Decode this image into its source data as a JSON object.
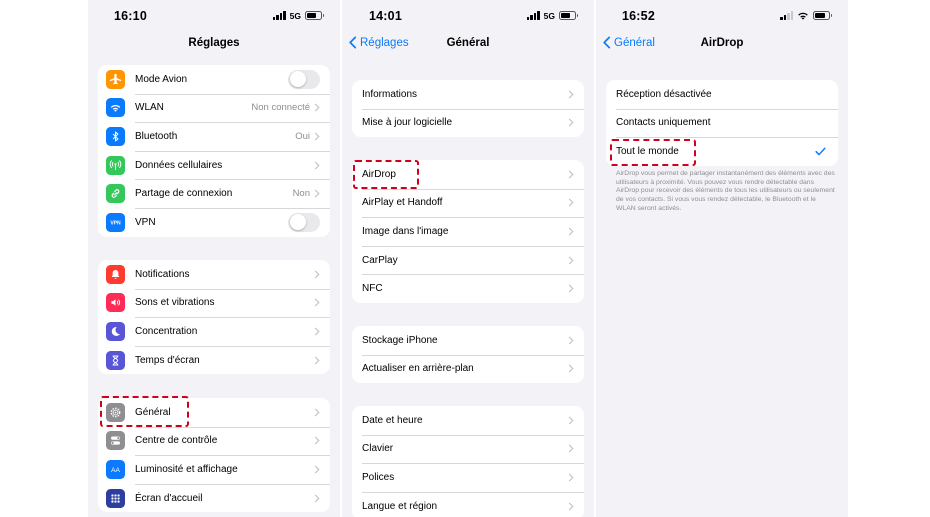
{
  "colors": {
    "accent": "#0a7aff",
    "highlight": "#d0021b",
    "background": "#f2f2f7",
    "secondary_text": "#8e8e93"
  },
  "screen1": {
    "status": {
      "time": "16:10",
      "network": "5G"
    },
    "title": "Réglages",
    "group1": [
      {
        "label": "Mode Avion",
        "icon": "airplane-icon",
        "color": "#ff9500",
        "control": "toggle",
        "toggle_on": false
      },
      {
        "label": "WLAN",
        "icon": "wifi-icon",
        "color": "#0a7aff",
        "value": "Non connecté"
      },
      {
        "label": "Bluetooth",
        "icon": "bluetooth-icon",
        "color": "#0a7aff",
        "value": "Oui"
      },
      {
        "label": "Données cellulaires",
        "icon": "cellular-antenna-icon",
        "color": "#34c759"
      },
      {
        "label": "Partage de connexion",
        "icon": "link-icon",
        "color": "#34c759",
        "value": "Non"
      },
      {
        "label": "VPN",
        "icon": "vpn-icon",
        "color": "#0a7aff",
        "control": "toggle",
        "toggle_on": false
      }
    ],
    "group2": [
      {
        "label": "Notifications",
        "icon": "bell-icon",
        "color": "#ff3b30"
      },
      {
        "label": "Sons et vibrations",
        "icon": "speaker-icon",
        "color": "#ff2d55"
      },
      {
        "label": "Concentration",
        "icon": "moon-icon",
        "color": "#5856d6"
      },
      {
        "label": "Temps d'écran",
        "icon": "hourglass-icon",
        "color": "#5856d6"
      }
    ],
    "group3": [
      {
        "label": "Général",
        "icon": "gear-icon",
        "color": "#8e8e93"
      },
      {
        "label": "Centre de contrôle",
        "icon": "toggles-icon",
        "color": "#8e8e93"
      },
      {
        "label": "Luminosité et affichage",
        "icon": "text-size-icon",
        "color": "#0a7aff"
      },
      {
        "label": "Écran d'accueil",
        "icon": "grid-icon",
        "color": "#2c3e9f"
      }
    ]
  },
  "screen2": {
    "status": {
      "time": "14:01",
      "network": "5G"
    },
    "back_label": "Réglages",
    "title": "Général",
    "group1": [
      {
        "label": "Informations"
      },
      {
        "label": "Mise à jour logicielle"
      }
    ],
    "group2": [
      {
        "label": "AirDrop"
      },
      {
        "label": "AirPlay et Handoff"
      },
      {
        "label": "Image dans l'image"
      },
      {
        "label": "CarPlay"
      },
      {
        "label": "NFC"
      }
    ],
    "group3": [
      {
        "label": "Stockage iPhone"
      },
      {
        "label": "Actualiser en arrière-plan"
      }
    ],
    "group4": [
      {
        "label": "Date et heure"
      },
      {
        "label": "Clavier"
      },
      {
        "label": "Polices"
      },
      {
        "label": "Langue et région"
      }
    ]
  },
  "screen3": {
    "status": {
      "time": "16:52"
    },
    "back_label": "Général",
    "title": "AirDrop",
    "options": [
      {
        "label": "Réception désactivée",
        "selected": false
      },
      {
        "label": "Contacts uniquement",
        "selected": false
      },
      {
        "label": "Tout le monde",
        "selected": true
      }
    ],
    "footnote": "AirDrop vous permet de partager instantanément des éléments avec des utilisateurs à proximité. Vous pouvez vous rendre détectable dans AirDrop pour recevoir des éléments de tous les utilisateurs ou seulement de vos contacts. Si vous vous rendez détectable, le Bluetooth et le WLAN seront activés."
  }
}
